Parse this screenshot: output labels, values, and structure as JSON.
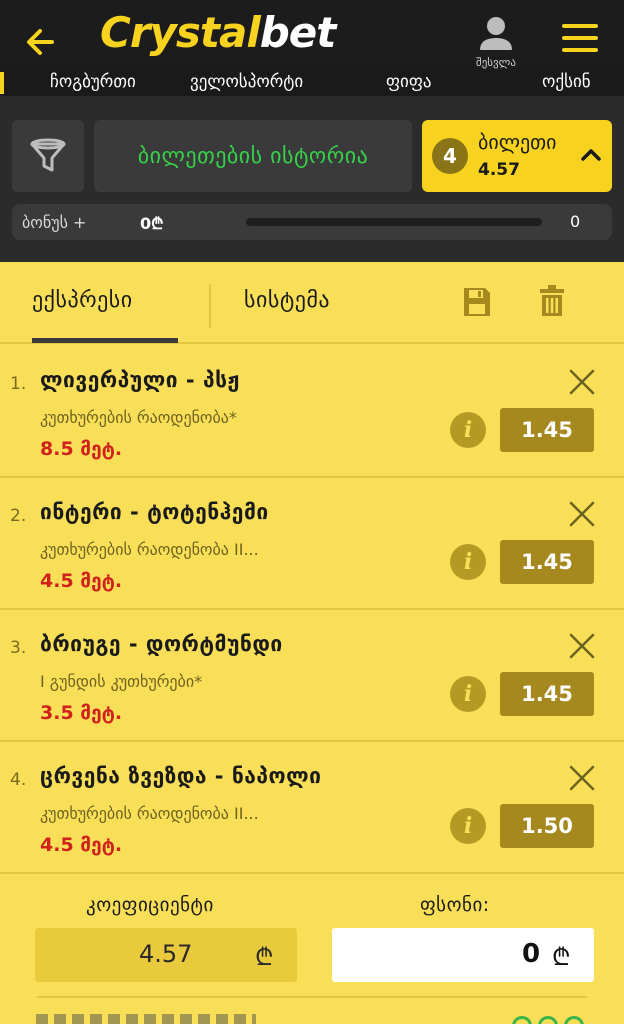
{
  "header": {
    "logo_part1": "Crystal",
    "logo_part2": "bet",
    "user_label": "შესვლა"
  },
  "nav": {
    "items": [
      "ჩოგბურთი",
      "ველოსპორტი",
      "ფიფა",
      "ოქსინ"
    ]
  },
  "controls": {
    "history_label": "ბილეთების ისტორია",
    "tickets_count": "4",
    "tickets_label": "ბილეთი",
    "tickets_odds": "4.57",
    "bonus_label": "ბონუს +",
    "bonus_amount": "0₾",
    "bonus_progress": 0,
    "bonus_count": "0"
  },
  "slip": {
    "tab_express": "ექსპრესი",
    "tab_system": "სისტემა",
    "bets": [
      {
        "index": "1.",
        "title": "ლივერპული - პსჟ",
        "market": "კუთხურების რაოდენობა*",
        "line": "8.5 მეტ.",
        "odds": "1.45"
      },
      {
        "index": "2.",
        "title": "ინტერი - ტოტენჰემი",
        "market": "კუთხურების რაოდენობა II...",
        "line": "4.5 მეტ.",
        "odds": "1.45"
      },
      {
        "index": "3.",
        "title": "ბრიუგე - დორტმუნდი",
        "market": "I გუნდის კუთხურები*",
        "line": "3.5 მეტ.",
        "odds": "1.45"
      },
      {
        "index": "4.",
        "title": "ცრვენა ზვეზდა - ნაპოლი",
        "market": "კუთხურების რაოდენობა II...",
        "line": "4.5 მეტ.",
        "odds": "1.50"
      }
    ],
    "coef_label": "კოეფიციენტი",
    "coef_value": "4.57",
    "stake_label": "ფსონი:",
    "stake_value": "0",
    "currency": "₾"
  },
  "colors": {
    "brand_yellow": "#f7d21f",
    "slip_bg": "#f9df58",
    "history_green": "#35d24a",
    "line_red": "#d0211c"
  }
}
